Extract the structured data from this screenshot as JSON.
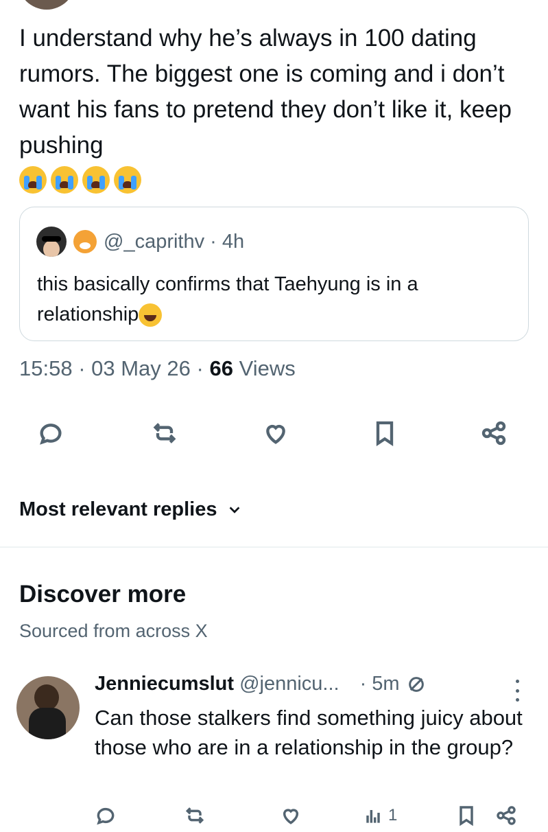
{
  "tweet": {
    "text": "I understand why he’s always in 100 dating rumors. The biggest one is coming and i don’t want his fans to pretend they don’t like it, keep pushing",
    "emoji_count": 4,
    "emoji": "loudly-crying-face"
  },
  "quote": {
    "handle": "@_caprithv",
    "time": "4h",
    "text": "this basically confirms that Taehyung is in a relationship",
    "trailing_emoji": "grinning-face"
  },
  "meta": {
    "time": "15:58",
    "date": "03 May 26",
    "views_count": "66",
    "views_label": "Views"
  },
  "actions": [
    "reply-icon",
    "retweet-icon",
    "like-icon",
    "bookmark-icon",
    "share-icon"
  ],
  "sort": {
    "label": "Most relevant replies"
  },
  "discover": {
    "title": "Discover more",
    "subtitle": "Sourced from across X"
  },
  "reply": {
    "name": "Jenniecumslut",
    "handle": "@jennicu...",
    "time": "· 5m",
    "text": "Can those stalkers find something juicy about those who are in a relationship in the group?",
    "views": "1"
  },
  "colors": {
    "text": "#0f1419",
    "secondary": "#536471",
    "border": "#cfd9de"
  }
}
